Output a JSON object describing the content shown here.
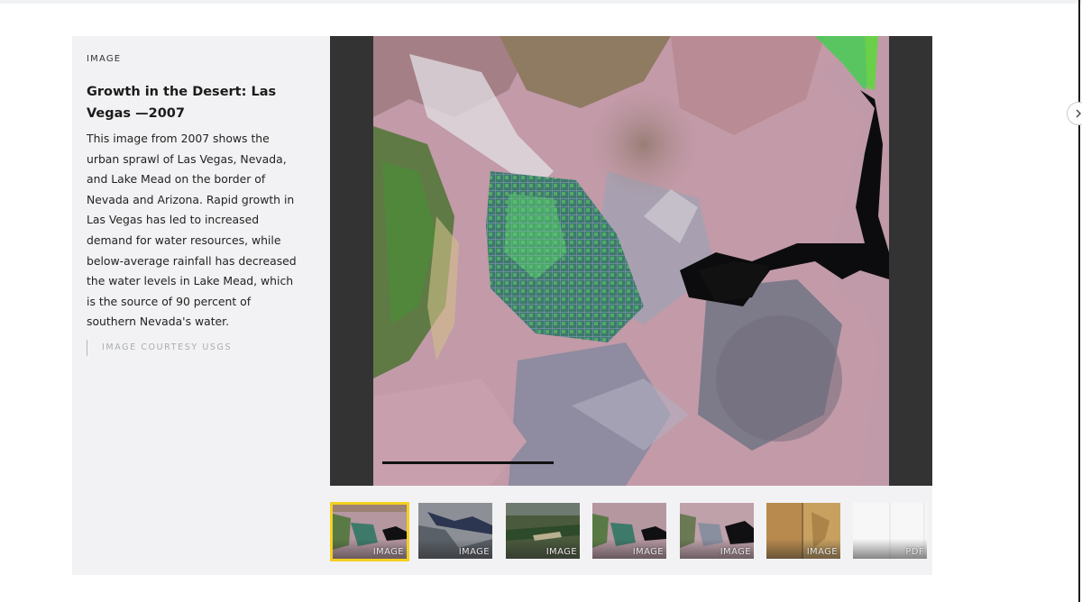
{
  "panel": {
    "section_label": "IMAGE",
    "title": "Growth in the Desert: Las Vegas —2007",
    "description": "This image from 2007 shows the urban sprawl of Las Vegas, Nevada, and Lake Mead on the border of Nevada and Arizona. Rapid growth in Las Vegas has led to increased demand for water resources, while below-average rainfall has decreased the water levels in Lake Mead, which is the source of 90 percent of southern Nevada's water.",
    "credit": "IMAGE COURTESY USGS"
  },
  "thumbnails": [
    {
      "label": "IMAGE",
      "active": true
    },
    {
      "label": "IMAGE",
      "active": false
    },
    {
      "label": "IMAGE",
      "active": false
    },
    {
      "label": "IMAGE",
      "active": false
    },
    {
      "label": "IMAGE",
      "active": false
    },
    {
      "label": "IMAGE",
      "active": false
    },
    {
      "label": "PDF",
      "active": false
    }
  ],
  "colors": {
    "active_border": "#f4d020",
    "viewer_bg": "#333333",
    "panel_bg": "#f2f2f4"
  },
  "icons": {
    "edge_button": "arrow-icon"
  }
}
